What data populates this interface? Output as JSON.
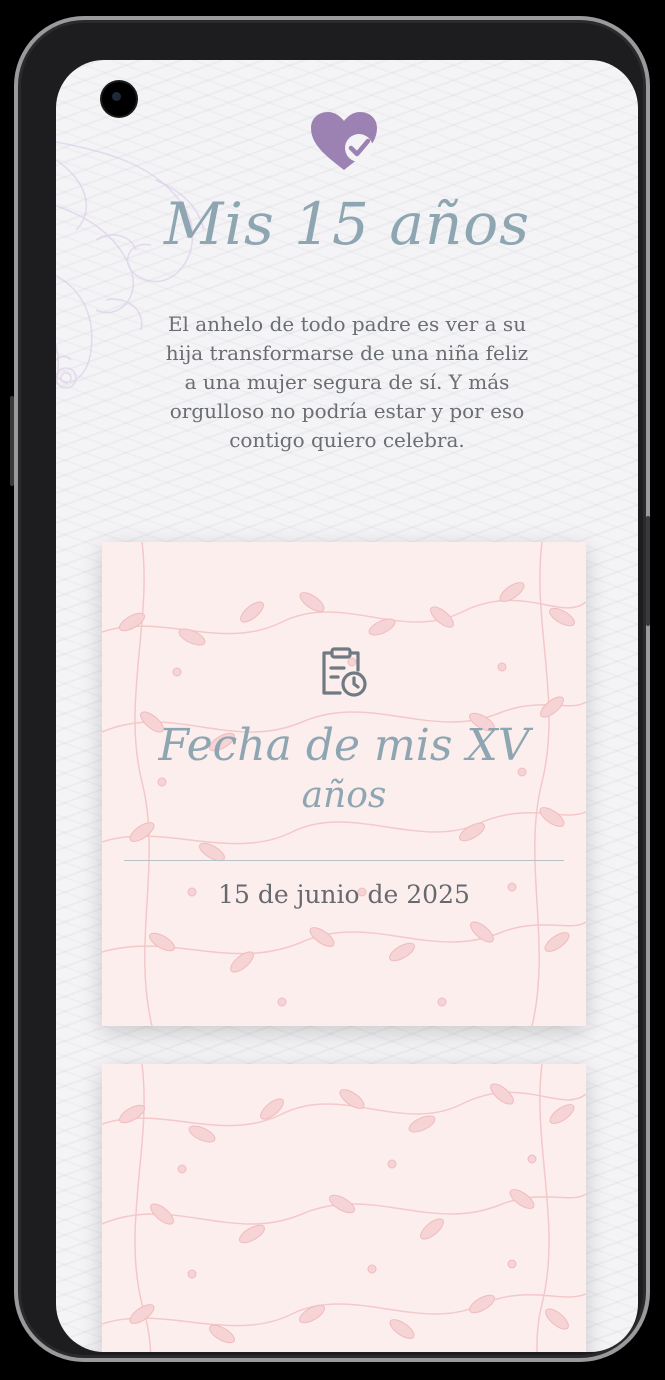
{
  "header": {
    "icon": "heart-check-icon",
    "title": "Mis 15 años",
    "intro_line1": "El anhelo de todo padre es ver a su",
    "intro_line2": "hija transformarse de una niña feliz",
    "intro_line3": "a una mujer segura de sí. Y más",
    "intro_line4": "orgulloso no podría estar y por eso",
    "intro_line5": "contigo quiero celebra."
  },
  "date_card": {
    "icon": "calendar-clock-icon",
    "title_line1": "Fecha de mis XV",
    "title_line2": "años",
    "date": "15 de junio de 2025"
  },
  "colors": {
    "accent_purple": "#9b82b3",
    "title_blue_gray": "#8ea6b1",
    "card_pink": "#fdeeee",
    "leaf_pink": "#f2c4c6",
    "body_text": "#6a6e72"
  }
}
